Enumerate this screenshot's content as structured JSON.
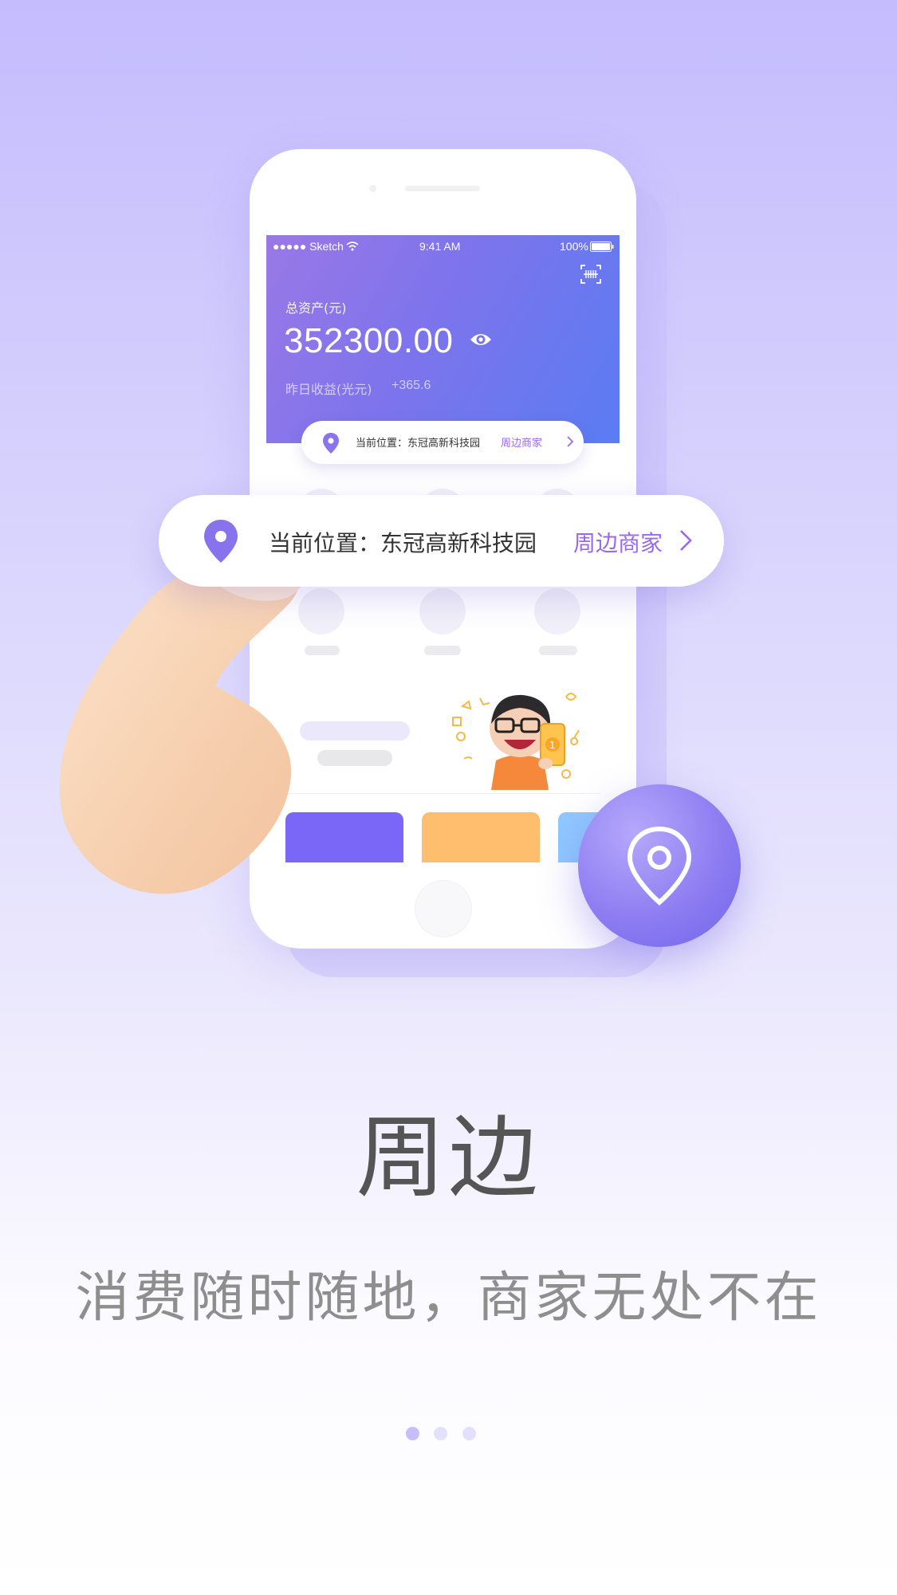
{
  "phone": {
    "status_bar": {
      "carrier": "●●●●● Sketch",
      "time": "9:41 AM",
      "battery": "100%"
    },
    "total_assets_label": "总资产(元)",
    "total_assets_value": "352300.00",
    "yesterday_earnings_label": "昨日收益(光元)",
    "yesterday_earnings_value": "+365.6",
    "location_small": {
      "text": "当前位置：东冠高新科技园",
      "link": "周边商家"
    }
  },
  "location_bar": {
    "text": "当前位置：东冠高新科技园",
    "link": "周边商家"
  },
  "title": "周边",
  "subtitle": "消费随时随地，商家无处不在",
  "pagination": {
    "pages": 3,
    "current_index": 0,
    "active_color": "#c5befa",
    "inactive_color": "#e3e0fb"
  },
  "colors": {
    "accent": "#9a68ee",
    "card_purple": "#7a67f7",
    "card_orange": "#ffbd6e",
    "card_blue": "#8fc8ff"
  },
  "icons": [
    "scan-icon",
    "eye-icon",
    "location-pin-icon",
    "chevron-right-icon",
    "hand-illustration",
    "mascot-illustration"
  ]
}
